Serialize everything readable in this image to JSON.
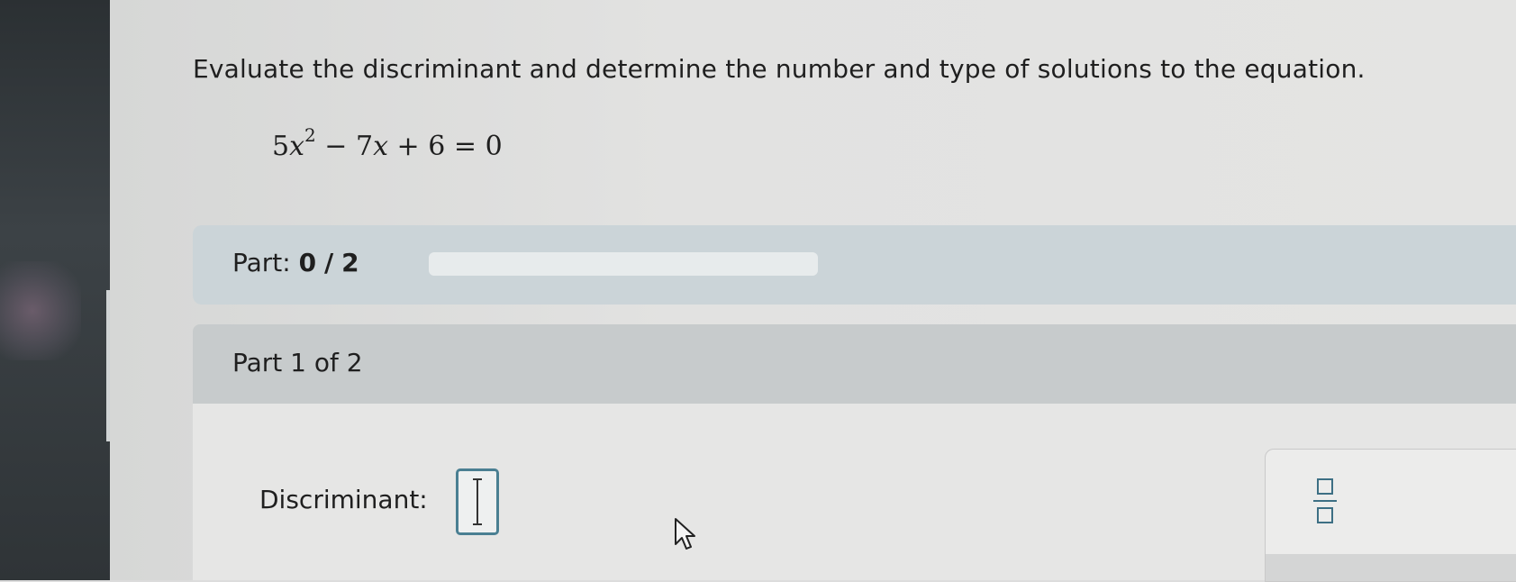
{
  "question": {
    "prompt": "Evaluate the discriminant and determine the number and type of solutions to the equation.",
    "equation": {
      "coef_a": "5",
      "var": "x",
      "exponent": "2",
      "minus": "−",
      "coef_b": "7",
      "plus": "+",
      "constant": "6",
      "equals": "=",
      "rhs": "0"
    }
  },
  "progress": {
    "label": "Part:",
    "completed": "0",
    "separator": "/",
    "total": "2",
    "fraction_complete": 0
  },
  "part": {
    "title": "Part 1 of 2",
    "discriminant_label": "Discriminant:",
    "answer_value": ""
  },
  "colors": {
    "accent": "#4a7f92",
    "progress_bg": "#cbd4d8",
    "part_header_bg": "#c7cbcc"
  },
  "icons": {
    "text_caret": "text-caret-icon",
    "mouse_pointer": "mouse-pointer-icon",
    "fraction_template": "fraction-icon"
  }
}
